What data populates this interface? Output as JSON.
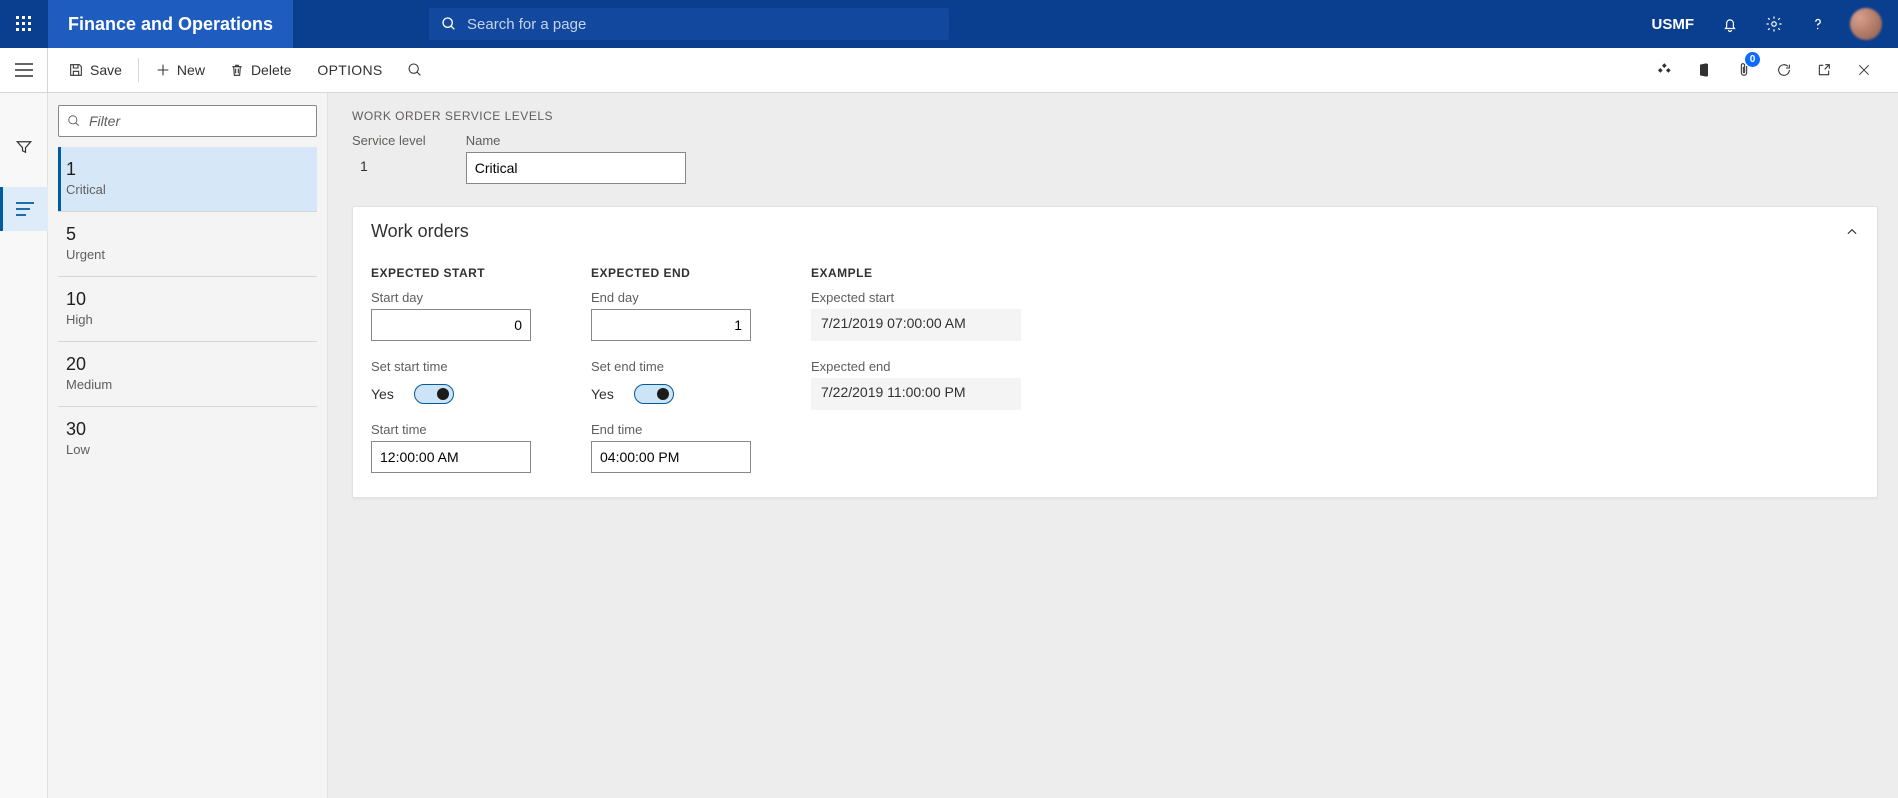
{
  "topbar": {
    "title": "Finance and Operations",
    "search_placeholder": "Search for a page",
    "org": "USMF"
  },
  "actionbar": {
    "save": "Save",
    "new": "New",
    "delete": "Delete",
    "options": "OPTIONS",
    "attach_badge": "0"
  },
  "list": {
    "filter_placeholder": "Filter",
    "items": [
      {
        "num": "1",
        "label": "Critical"
      },
      {
        "num": "5",
        "label": "Urgent"
      },
      {
        "num": "10",
        "label": "High"
      },
      {
        "num": "20",
        "label": "Medium"
      },
      {
        "num": "30",
        "label": "Low"
      }
    ]
  },
  "detail": {
    "breadcrumb": "WORK ORDER SERVICE LEVELS",
    "service_level_label": "Service level",
    "service_level_value": "1",
    "name_label": "Name",
    "name_value": "Critical",
    "card_title": "Work orders",
    "expected_start": {
      "heading": "EXPECTED START",
      "start_day_label": "Start day",
      "start_day_value": "0",
      "set_start_time_label": "Set start time",
      "set_start_time_value": "Yes",
      "start_time_label": "Start time",
      "start_time_value": "12:00:00 AM"
    },
    "expected_end": {
      "heading": "EXPECTED END",
      "end_day_label": "End day",
      "end_day_value": "1",
      "set_end_time_label": "Set end time",
      "set_end_time_value": "Yes",
      "end_time_label": "End time",
      "end_time_value": "04:00:00 PM"
    },
    "example": {
      "heading": "EXAMPLE",
      "expected_start_label": "Expected start",
      "expected_start_value": "7/21/2019 07:00:00 AM",
      "expected_end_label": "Expected end",
      "expected_end_value": "7/22/2019 11:00:00 PM"
    }
  }
}
